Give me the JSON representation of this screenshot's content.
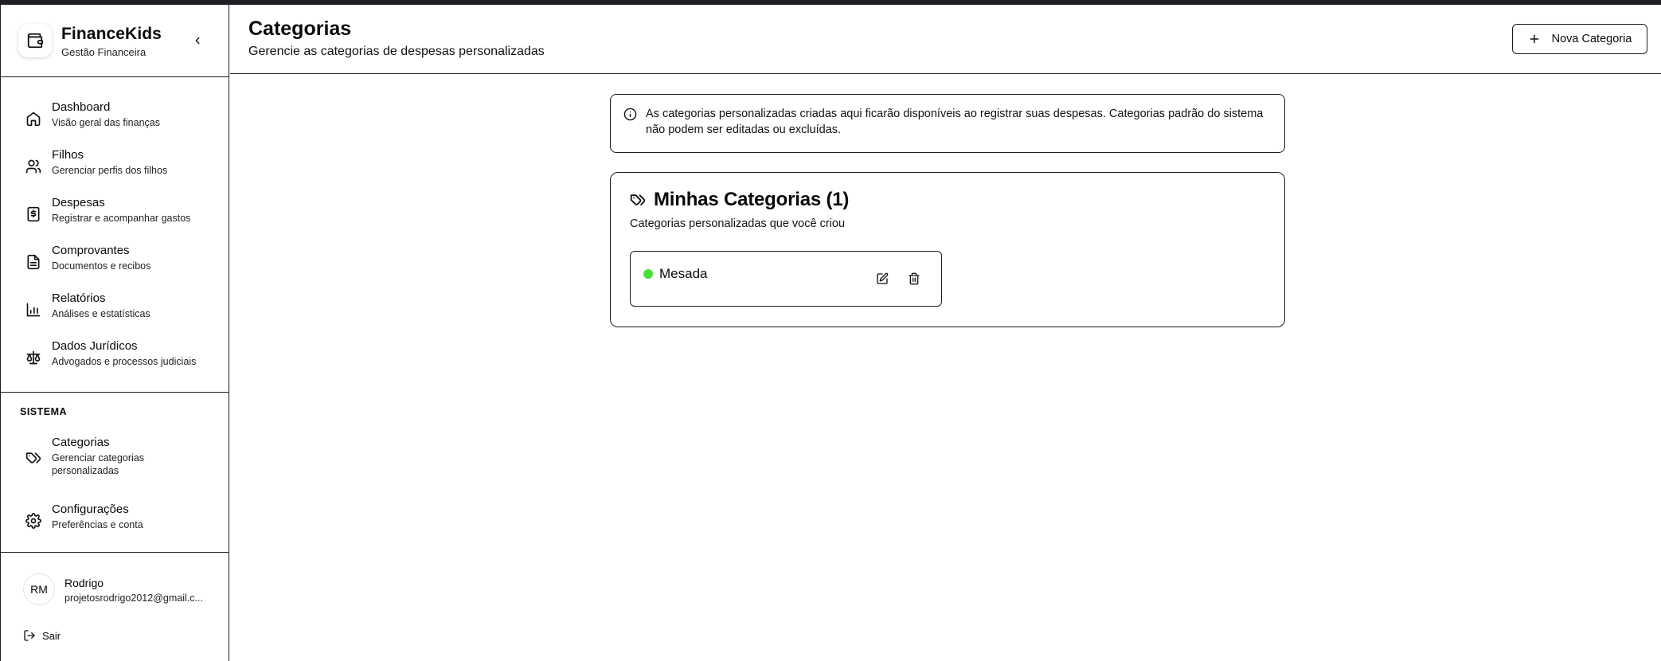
{
  "brand": {
    "title": "FinanceKids",
    "subtitle": "Gestão Financeira",
    "logo_icon": "wallet-icon",
    "collapse_icon": "chevron-left-icon"
  },
  "nav": {
    "items": [
      {
        "label": "Dashboard",
        "desc": "Visão geral das finanças",
        "icon": "home-icon"
      },
      {
        "label": "Filhos",
        "desc": "Gerenciar perfis dos filhos",
        "icon": "users-icon"
      },
      {
        "label": "Despesas",
        "desc": "Registrar e acompanhar gastos",
        "icon": "receipt-dollar-icon"
      },
      {
        "label": "Comprovantes",
        "desc": "Documentos e recibos",
        "icon": "file-text-icon"
      },
      {
        "label": "Relatórios",
        "desc": "Análises e estatísticas",
        "icon": "bar-chart-icon"
      },
      {
        "label": "Dados Jurídicos",
        "desc": "Advogados e processos judiciais",
        "icon": "scale-icon"
      }
    ],
    "section_label": "SISTEMA",
    "system_items": [
      {
        "label": "Categorias",
        "desc_line1": "Gerenciar categorias",
        "desc_line2": "personalizadas",
        "icon": "tags-icon"
      },
      {
        "label": "Configurações",
        "desc": "Preferências e conta",
        "icon": "gear-icon"
      }
    ]
  },
  "user": {
    "initials": "RM",
    "name": "Rodrigo",
    "email": "projetosrodrigo2012@gmail.c...",
    "logout_label": "Sair",
    "logout_icon": "logout-icon"
  },
  "header": {
    "title": "Categorias",
    "subtitle": "Gerencie as categorias de despesas personalizadas",
    "new_button_label": "Nova Categoria",
    "new_button_icon": "plus-icon"
  },
  "info": {
    "icon": "info-icon",
    "text": "As categorias personalizadas criadas aqui ficarão disponíveis ao registrar suas despesas. Categorias padrão do sistema não podem ser editadas ou excluídas."
  },
  "my_categories": {
    "title": "Minhas Categorias (1)",
    "title_icon": "tags-icon",
    "subtitle": "Categorias personalizadas que você criou",
    "items": [
      {
        "name": "Mesada",
        "color": "#4ade3a",
        "edit_icon": "edit-icon",
        "delete_icon": "trash-icon"
      }
    ]
  }
}
